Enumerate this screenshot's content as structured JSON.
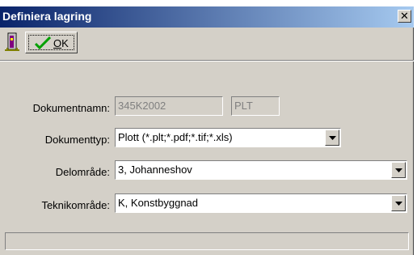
{
  "window": {
    "title": "Definiera lagring"
  },
  "toolbar": {
    "ok_label_underlined": "O",
    "ok_label_rest": "K"
  },
  "form": {
    "dokumentnamn": {
      "label": "Dokumentnamn:",
      "value": "345K2002",
      "suffix": "PLT"
    },
    "dokumenttyp": {
      "label": "Dokumenttyp:",
      "selected": "Plott (*.plt;*.pdf;*.tif;*.xls)"
    },
    "delomrade": {
      "label": "Delområde:",
      "selected": "3, Johanneshov"
    },
    "teknikomrade": {
      "label": "Teknikområde:",
      "selected": "K,  Konstbyggnad"
    }
  },
  "icons": {
    "exit": "exit-door-icon",
    "ok": "checkmark-icon",
    "close": "close-icon",
    "dropdown": "chevron-down-icon"
  }
}
